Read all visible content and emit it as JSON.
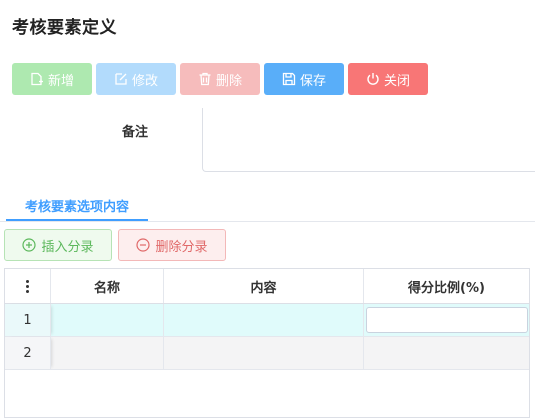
{
  "page": {
    "title": "考核要素定义"
  },
  "toolbar": {
    "new_label": "新增",
    "edit_label": "修改",
    "delete_label": "删除",
    "save_label": "保存",
    "close_label": "关闭"
  },
  "form": {
    "note_label": "备注",
    "note_value": ""
  },
  "tabs": [
    {
      "label": "考核要素选项内容",
      "active": true
    }
  ],
  "section_toolbar": {
    "insert_label": "插入分录",
    "delete_label": "删除分录"
  },
  "table": {
    "columns": [
      "名称",
      "内容",
      "得分比例(%)"
    ],
    "rows": [
      {
        "index": "1",
        "name": "",
        "content": "",
        "ratio": ""
      },
      {
        "index": "2",
        "name": "",
        "content": "",
        "ratio": ""
      }
    ]
  },
  "colors": {
    "primary": "#409eff",
    "success": "#5cb85c",
    "danger": "#f87676",
    "selected_row": "#e0fbfb"
  }
}
